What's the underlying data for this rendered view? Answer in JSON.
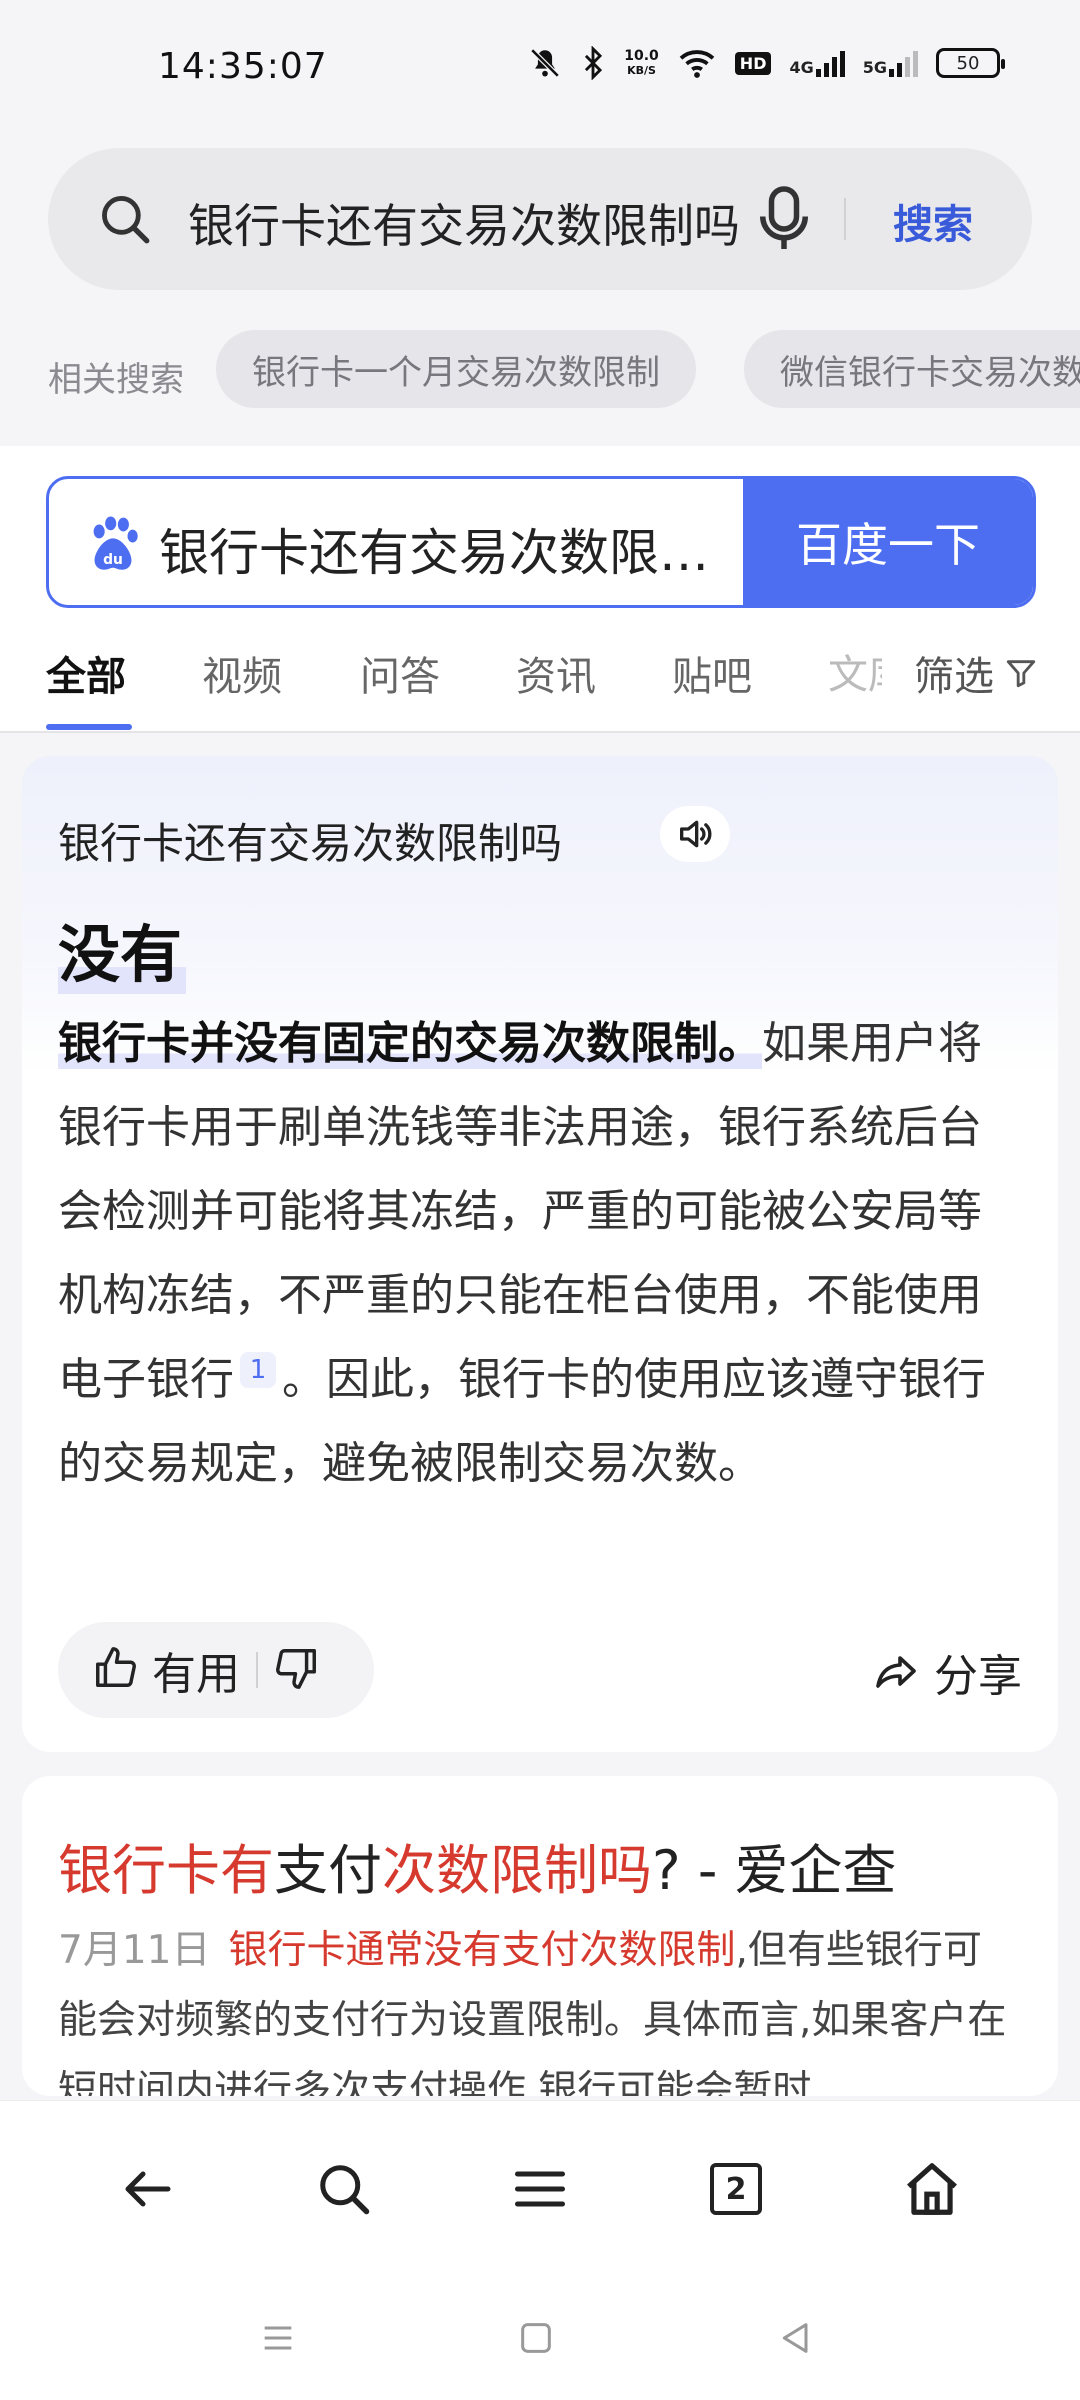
{
  "status": {
    "time": "14:35:07",
    "net_speed_value": "10.0",
    "net_speed_unit": "KB/S",
    "hd_label": "HD",
    "net1_label": "4G",
    "net2_label": "5G",
    "battery": "50"
  },
  "top_search": {
    "query": "银行卡还有交易次数限制吗",
    "search_label": "搜索"
  },
  "related": {
    "label": "相关搜索",
    "chips": [
      "银行卡一个月交易次数限制",
      "微信银行卡交易次数"
    ]
  },
  "baidu": {
    "query": "银行卡还有交易次数限制吗",
    "button_label": "百度一下"
  },
  "tabs": {
    "items": [
      "全部",
      "视频",
      "问答",
      "资讯",
      "贴吧"
    ],
    "faded": "文库",
    "filter_label": "筛选"
  },
  "answer": {
    "question": "银行卡还有交易次数限制吗",
    "answer_word": "没有",
    "highlight": "银行卡并没有固定的交易次数限制。",
    "body_part1": "如果用户将银行卡用于刷单洗钱等非法用途，银行系统后台会检测并可能将其冻结，严重的可能被公安局等机构冻结，不严重的只能在柜台使用，不能使用电子银行",
    "citation": "1",
    "body_part2": "。因此，银行卡的使用应该遵守银行的交易规定，避免被限制交易次数。",
    "useful_label": "有用",
    "share_label": "分享"
  },
  "result": {
    "title_red1": "银行卡有",
    "title_plain1": "支付",
    "title_red2": "次数限制吗",
    "title_plain2": "? - 爱企查",
    "date": "7月11日",
    "snippet_red": "银行卡通常没有支付次数限制",
    "snippet_rest": ",但有些银行可能会对频繁的支付行为设置限制。具体而言,如果客户在短时间内进行多次支付操作,银行可能会暂时..."
  },
  "bottom_nav": {
    "tab_count": "2"
  },
  "colors": {
    "accent": "#4e6ef2",
    "search_text": "#3a5bd9",
    "keyword_red": "#d63a2e"
  }
}
